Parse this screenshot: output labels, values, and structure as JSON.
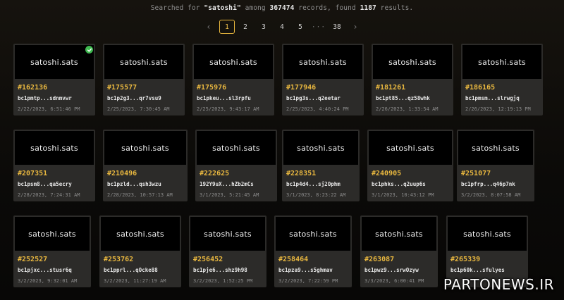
{
  "summary": {
    "prefix": "Searched for ",
    "query": "\"satoshi\"",
    "among": " among ",
    "records": "367474",
    "records_suffix": " records, found ",
    "found": "1187",
    "found_suffix": " results."
  },
  "pagination": {
    "prev": "‹",
    "pages": [
      "1",
      "2",
      "3",
      "4",
      "5"
    ],
    "ellipsis": "···",
    "last": "38",
    "next": "›",
    "current": "1"
  },
  "accent_color": "#e6b53d",
  "cards": [
    {
      "name": "satoshi.sats",
      "number": "#162136",
      "address": "bc1pmtp...sdnmvwr",
      "date": "2/22/2023, 6:51:46 PM",
      "verified": true
    },
    {
      "name": "satoshi.sats",
      "number": "#175577",
      "address": "bc1p2g3...qr7vsu9",
      "date": "2/25/2023, 7:30:45 AM"
    },
    {
      "name": "satoshi.sats",
      "number": "#175976",
      "address": "bc1pkeu...sl3rpfu",
      "date": "2/25/2023, 9:43:17 AM"
    },
    {
      "name": "satoshi.sats",
      "number": "#177946",
      "address": "bc1pg3s...q2eetar",
      "date": "2/25/2023, 4:40:24 PM"
    },
    {
      "name": "satoshi.sats",
      "number": "#181261",
      "address": "bc1pt85...qz58whk",
      "date": "2/26/2023, 1:33:54 AM"
    },
    {
      "name": "satoshi.sats",
      "number": "#186165",
      "address": "bc1pmsm...slrwgjq",
      "date": "2/26/2023, 12:19:13 PM"
    },
    {
      "name": "satoshi.sats",
      "number": "#207351",
      "address": "bc1psm8...qa5ecry",
      "date": "2/28/2023, 7:24:31 AM"
    },
    {
      "name": "satoshi.sats",
      "number": "#210496",
      "address": "bc1pzld...qsh3wzu",
      "date": "2/28/2023, 10:57:13 AM"
    },
    {
      "name": "satoshi.sats",
      "number": "#222625",
      "address": "192Y9uX...hZb2mCs",
      "date": "3/1/2023, 5:21:45 AM"
    },
    {
      "name": "satoshi.sats",
      "number": "#228351",
      "address": "bc1p4d4...sj2Ophm",
      "date": "3/1/2023, 8:23:22 AM"
    },
    {
      "name": "satoshi.sats",
      "number": "#240905",
      "address": "bc1phks...q2uup6s",
      "date": "3/1/2023, 10:43:12 PM"
    },
    {
      "name": "satoshi.sats",
      "number": "#251077",
      "address": "bc1pfrp...q46p7nk",
      "date": "3/2/2023, 8:07:58 AM"
    },
    {
      "name": "satoshi.sats",
      "number": "#252527",
      "address": "bc1pjxc...stusr6q",
      "date": "3/2/2023, 9:32:01 AM"
    },
    {
      "name": "satoshi.sats",
      "number": "#253762",
      "address": "bc1pprl...qOcke88",
      "date": "3/2/2023, 11:27:19 AM"
    },
    {
      "name": "satoshi.sats",
      "number": "#256452",
      "address": "bc1pje6...shz9h98",
      "date": "3/2/2023, 1:52:25 PM"
    },
    {
      "name": "satoshi.sats",
      "number": "#258464",
      "address": "bc1pza9...s5ghmav",
      "date": "3/2/2023, 7:22:59 PM"
    },
    {
      "name": "satoshi.sats",
      "number": "#263087",
      "address": "bc1pwz9...srwOzyw",
      "date": "3/3/2023, 6:00:41 PM"
    },
    {
      "name": "satoshi.sats",
      "number": "#265339",
      "address": "bc1p60k...sfulyes",
      "date": ""
    }
  ],
  "watermark": "PARTONEWS.IR"
}
